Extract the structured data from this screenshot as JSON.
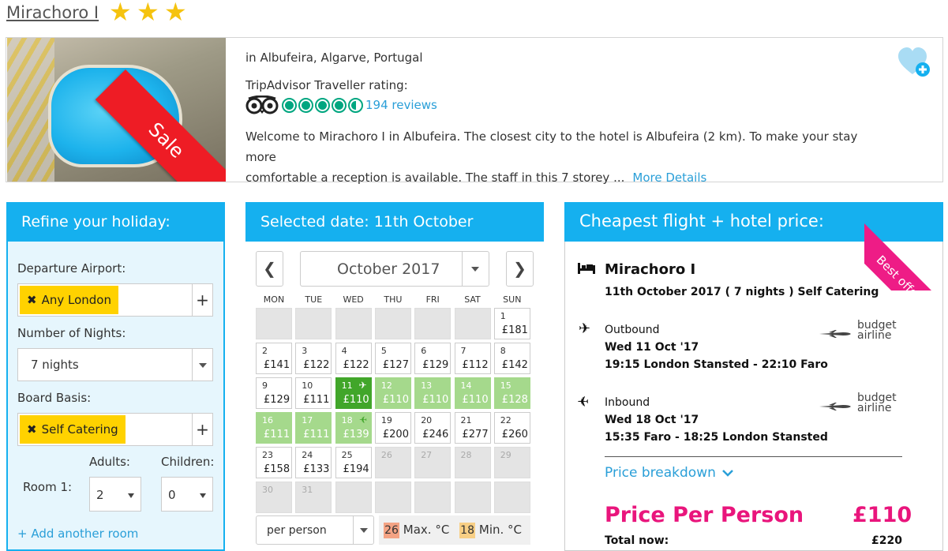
{
  "hotel": {
    "name": "Mirachoro I",
    "stars": 3,
    "star_glyph": "★",
    "sale_label": "Sale",
    "location": "in Albufeira, Algarve, Portugal",
    "rating_label": "TripAdvisor Traveller rating:",
    "rating_bubbles": 4.5,
    "reviews": "194 reviews",
    "description_line1": "Welcome to Mirachoro I in Albufeira. The closest city to the hotel is Albufeira (2 km). To make your stay more",
    "description_line2": "comfortable a reception is available. The staff in this 7 storey ...",
    "more_details": "More Details",
    "favourite_icon": "heart-plus-icon"
  },
  "refine": {
    "title": "Refine your holiday:",
    "departure_label": "Departure Airport:",
    "departure_value": "Any London",
    "nights_label": "Number of Nights:",
    "nights_value": "7 nights",
    "board_label": "Board Basis:",
    "board_value": "Self Catering",
    "remove_glyph": "✖",
    "plus_glyph": "+",
    "adults_label": "Adults:",
    "children_label": "Children:",
    "room_label": "Room 1:",
    "adults_value": "2",
    "children_value": "0",
    "add_room": "+ Add another room"
  },
  "calendar": {
    "title": "Selected date: 11th October",
    "month": "October 2017",
    "prev_glyph": "❮",
    "next_glyph": "❯",
    "weekdays": [
      "MON",
      "TUE",
      "WED",
      "THU",
      "FRI",
      "SAT",
      "SUN"
    ],
    "plane_glyph": "✈",
    "days": [
      {
        "day": "",
        "price": "",
        "state": "empty"
      },
      {
        "day": "",
        "price": "",
        "state": "empty"
      },
      {
        "day": "",
        "price": "",
        "state": "empty"
      },
      {
        "day": "",
        "price": "",
        "state": "empty"
      },
      {
        "day": "",
        "price": "",
        "state": "empty"
      },
      {
        "day": "",
        "price": "",
        "state": "empty"
      },
      {
        "day": "1",
        "price": "£181",
        "state": "avail"
      },
      {
        "day": "2",
        "price": "£141",
        "state": "avail"
      },
      {
        "day": "3",
        "price": "£122",
        "state": "avail"
      },
      {
        "day": "4",
        "price": "£122",
        "state": "avail"
      },
      {
        "day": "5",
        "price": "£127",
        "state": "avail"
      },
      {
        "day": "6",
        "price": "£129",
        "state": "avail"
      },
      {
        "day": "7",
        "price": "£112",
        "state": "avail"
      },
      {
        "day": "8",
        "price": "£142",
        "state": "avail"
      },
      {
        "day": "9",
        "price": "£129",
        "state": "avail"
      },
      {
        "day": "10",
        "price": "£111",
        "state": "avail"
      },
      {
        "day": "11",
        "price": "£110",
        "state": "sel",
        "plane": "out"
      },
      {
        "day": "12",
        "price": "£110",
        "state": "green"
      },
      {
        "day": "13",
        "price": "£110",
        "state": "green"
      },
      {
        "day": "14",
        "price": "£110",
        "state": "green"
      },
      {
        "day": "15",
        "price": "£128",
        "state": "green"
      },
      {
        "day": "16",
        "price": "£111",
        "state": "green"
      },
      {
        "day": "17",
        "price": "£111",
        "state": "green"
      },
      {
        "day": "18",
        "price": "£139",
        "state": "green",
        "plane": "in"
      },
      {
        "day": "19",
        "price": "£200",
        "state": "avail"
      },
      {
        "day": "20",
        "price": "£246",
        "state": "avail"
      },
      {
        "day": "21",
        "price": "£277",
        "state": "avail"
      },
      {
        "day": "22",
        "price": "£260",
        "state": "avail"
      },
      {
        "day": "23",
        "price": "£158",
        "state": "avail"
      },
      {
        "day": "24",
        "price": "£133",
        "state": "avail"
      },
      {
        "day": "25",
        "price": "£194",
        "state": "avail"
      },
      {
        "day": "26",
        "price": "",
        "state": "empty"
      },
      {
        "day": "27",
        "price": "",
        "state": "empty"
      },
      {
        "day": "28",
        "price": "",
        "state": "empty"
      },
      {
        "day": "29",
        "price": "",
        "state": "empty"
      },
      {
        "day": "30",
        "price": "",
        "state": "empty"
      },
      {
        "day": "31",
        "price": "",
        "state": "empty"
      },
      {
        "day": "",
        "price": "",
        "state": "empty"
      },
      {
        "day": "",
        "price": "",
        "state": "empty"
      },
      {
        "day": "",
        "price": "",
        "state": "empty"
      },
      {
        "day": "",
        "price": "",
        "state": "empty"
      },
      {
        "day": "",
        "price": "",
        "state": "empty"
      }
    ],
    "per_select": "per person",
    "max_temp": "26",
    "max_label": "Max. °C",
    "min_temp": "18",
    "min_label": "Min. °C",
    "max_color": "#f4a384",
    "min_color": "#f8cf85"
  },
  "cheapest": {
    "title": "Cheapest flight + hotel price:",
    "best_offer": "Best offer",
    "hotel_name": "Mirachoro I",
    "stay_info": "11th October 2017 ( 7 nights ) Self Catering",
    "outbound_label": "Outbound",
    "outbound_date": "Wed 11 Oct '17",
    "outbound_route": "19:15 London Stansted - 22:10 Faro",
    "inbound_label": "Inbound",
    "inbound_date": "Wed 18 Oct '17",
    "inbound_route": "15:35 Faro - 18:25 London Stansted",
    "airline_line1": "budget",
    "airline_line2": "airline",
    "breakdown": "Price breakdown",
    "ppp_label": "Price Per Person",
    "ppp_value": "£110",
    "total_label": "Total now:",
    "total_value": "£220"
  },
  "colors": {
    "accent": "#15b0ef",
    "sale": "#ee1c25",
    "best_offer": "#ee1c86",
    "selected": "#41a62a",
    "range": "#a5d98c",
    "price": "#e9157c",
    "chip": "#ffd200"
  }
}
